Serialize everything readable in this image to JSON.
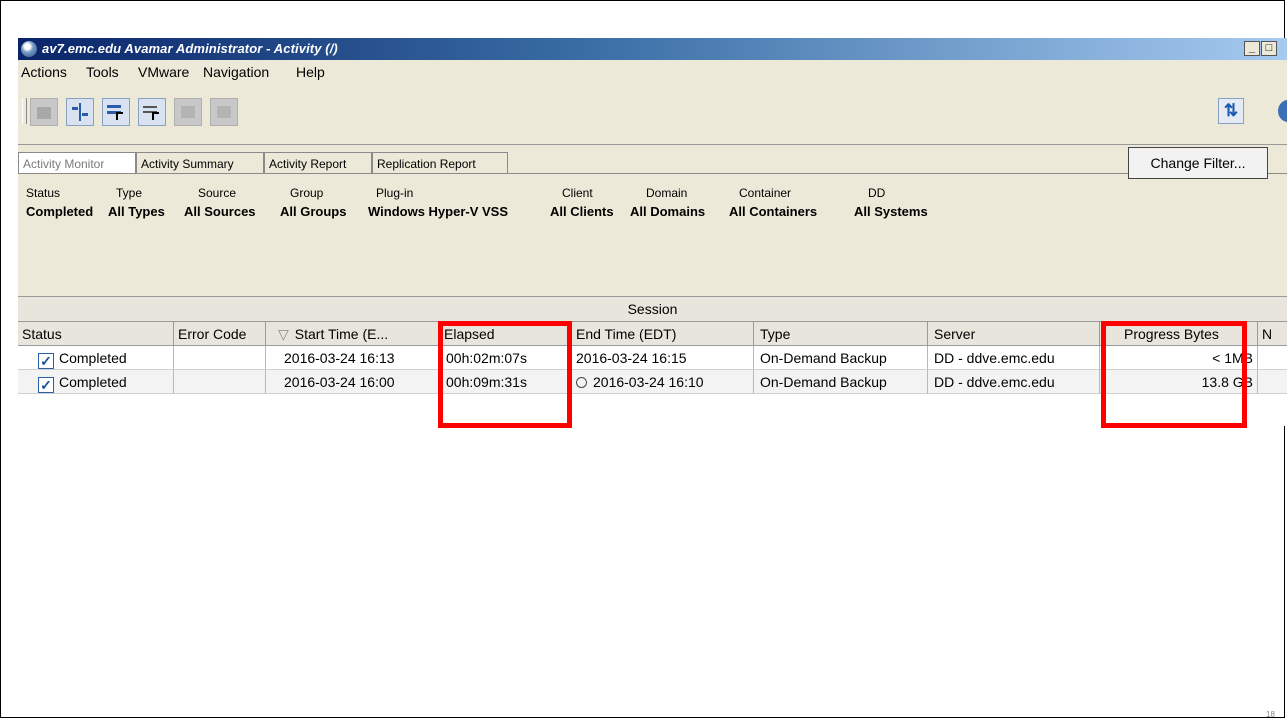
{
  "window": {
    "title": "av7.emc.edu Avamar Administrator - Activity (/)",
    "minimize_label": "_",
    "restore_label": "□"
  },
  "menu": [
    "Actions",
    "Tools",
    "VMware",
    "Navigation",
    "Help"
  ],
  "toolbar": {
    "buttons": [
      {
        "icon": "backup-icon",
        "enabled": false
      },
      {
        "icon": "split-pane-icon",
        "enabled": true
      },
      {
        "icon": "select-cursor-icon",
        "enabled": true
      },
      {
        "icon": "list-select-icon",
        "enabled": true
      },
      {
        "icon": "disabled-action-icon",
        "enabled": false
      },
      {
        "icon": "disabled-action-icon",
        "enabled": false
      }
    ],
    "refresh_icon": "⇅"
  },
  "tabs": [
    "Activity Monitor",
    "Activity Summary",
    "Activity Report",
    "Replication Report"
  ],
  "filters": [
    {
      "label": "Status",
      "value": "Completed"
    },
    {
      "label": "Type",
      "value": "All Types"
    },
    {
      "label": "Source",
      "value": "All Sources"
    },
    {
      "label": "Group",
      "value": "All Groups"
    },
    {
      "label": "Plug-in",
      "value": "Windows Hyper-V VSS"
    },
    {
      "label": "Client",
      "value": "All Clients"
    },
    {
      "label": "Domain",
      "value": "All Domains"
    },
    {
      "label": "Container",
      "value": "All Containers"
    },
    {
      "label": "DD",
      "value": "All Systems"
    }
  ],
  "change_filter_label": "Change Filter...",
  "table": {
    "group_header": "Session",
    "columns": [
      "Status",
      "Error Code",
      "Start Time (E...",
      "Elapsed",
      "End Time (EDT)",
      "Type",
      "Server",
      "Progress Bytes",
      "N"
    ],
    "sort_indicator": "▽",
    "rows": [
      {
        "status": "Completed",
        "error_code": "",
        "start_time": "2016-03-24 16:13",
        "elapsed": "00h:02m:07s",
        "end_time": "2016-03-24 16:15",
        "type": "On-Demand Backup",
        "server": "DD - ddve.emc.edu",
        "progress_bytes": "< 1MB"
      },
      {
        "status": "Completed",
        "error_code": "",
        "start_time": "2016-03-24 16:00",
        "elapsed": "00h:09m:31s",
        "end_time": "2016-03-24 16:10",
        "type": "On-Demand Backup",
        "server": "DD - ddve.emc.edu",
        "progress_bytes": "13.8 GB"
      }
    ]
  },
  "slide_number": "18",
  "colors": {
    "highlight": "#ff0000",
    "title_bar": "#0a246a",
    "window_bg": "#ece9d8"
  }
}
